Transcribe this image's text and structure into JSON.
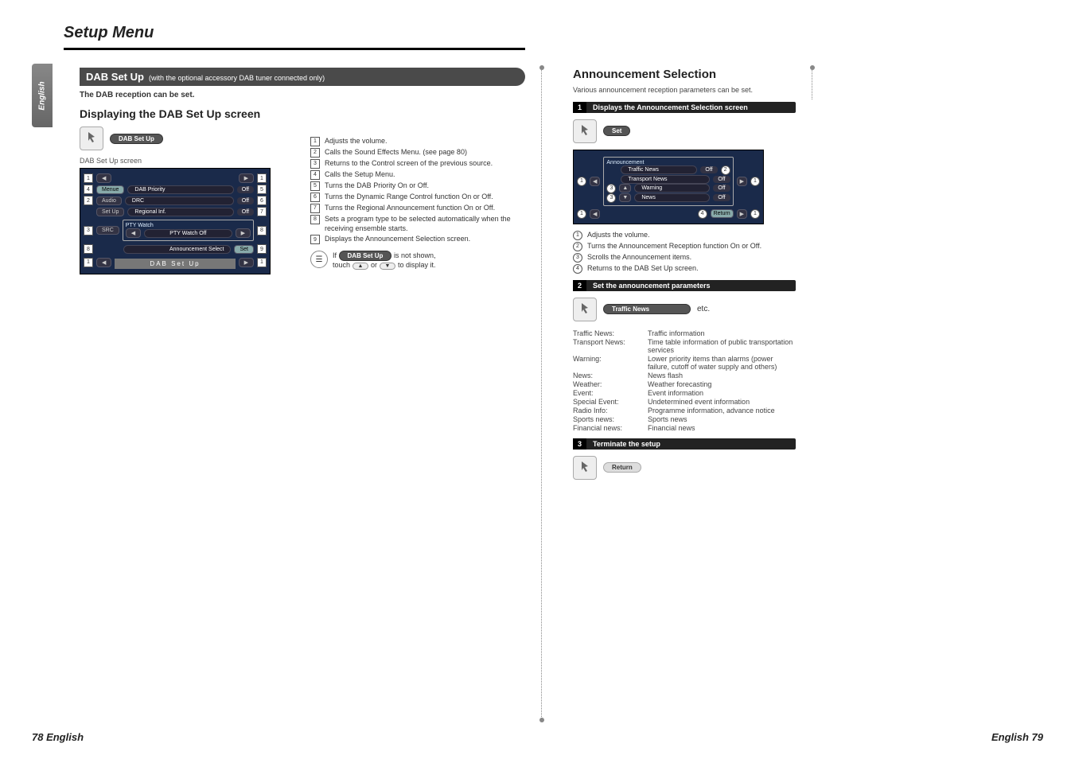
{
  "page": {
    "title": "Setup Menu",
    "lang_tab": "English",
    "footer_left": "78 English",
    "footer_right": "English 79"
  },
  "dab": {
    "banner_title": "DAB Set Up",
    "banner_sub": "(with the optional accessory DAB tuner connected only)",
    "intro": "The DAB reception can be set.",
    "heading": "Displaying the DAB Set Up screen",
    "tap_pill": "DAB Set Up",
    "caption": "DAB Set Up screen",
    "screen": {
      "menu_btn": "Menue",
      "audio_btn": "Audio",
      "setup_btn": "Set Up",
      "src_btn": "SRC",
      "row_priority": {
        "label": "DAB Priority",
        "val": "Off"
      },
      "row_drc": {
        "label": "DRC",
        "val": "Off"
      },
      "row_regional": {
        "label": "Regional Inf.",
        "val": "Off"
      },
      "pty_group": "PTY Watch",
      "row_pty": {
        "label": "PTY Watch Off"
      },
      "row_ann": {
        "label": "Announcement Select",
        "btn": "Set"
      },
      "title_band": "DAB  Set  Up"
    },
    "notes": [
      "Adjusts the volume.",
      "Calls the Sound Effects Menu. (see page 80)",
      "Returns to the Control screen of the previous source.",
      "Calls the Setup Menu.",
      "Turns the DAB Priority On or Off.",
      "Turns the Dynamic Range Control function On or Off.",
      "Turns the Regional Announcement function On or Off.",
      "Sets a program type to be selected automatically when the receiving ensemble starts.",
      "Displays the Announcement Selection screen."
    ],
    "tip_prefix": "If",
    "tip_pill": "DAB Set Up",
    "tip_mid": "is not shown,",
    "tip_line2a": "touch",
    "tip_line2b": "or",
    "tip_line2c": "to display it."
  },
  "ann": {
    "heading": "Announcement Selection",
    "intro": "Various announcement reception parameters can be set.",
    "step1": "Displays the Announcement Selection screen",
    "tap_pill": "Set",
    "screen": {
      "group": "Announcement",
      "rows": [
        {
          "label": "Traffic News",
          "val": "Off"
        },
        {
          "label": "Transport News",
          "val": "Off"
        },
        {
          "label": "Warning",
          "val": "Off"
        },
        {
          "label": "News",
          "val": "Off"
        }
      ],
      "return": "Return"
    },
    "circ_notes": [
      "Adjusts the volume.",
      "Turns the Announcement Reception function On or Off.",
      "Scrolls the Announcement items.",
      "Returns to the DAB Set Up screen."
    ],
    "step2": "Set the announcement parameters",
    "step2_pill": "Traffic News",
    "step2_etc": "etc.",
    "defs": [
      {
        "k": "Traffic News:",
        "v": "Traffic information"
      },
      {
        "k": "Transport News:",
        "v": "Time table information of public transportation services"
      },
      {
        "k": "Warning:",
        "v": "Lower priority items than alarms (power failure, cutoff of water supply and others)"
      },
      {
        "k": "News:",
        "v": "News flash"
      },
      {
        "k": "Weather:",
        "v": "Weather forecasting"
      },
      {
        "k": "Event:",
        "v": "Event information"
      },
      {
        "k": "Special Event:",
        "v": "Undetermined event information"
      },
      {
        "k": "Radio Info:",
        "v": "Programme information, advance notice"
      },
      {
        "k": "Sports news:",
        "v": "Sports news"
      },
      {
        "k": "Financial news:",
        "v": "Financial news"
      }
    ],
    "step3": "Terminate the setup",
    "step3_pill": "Return"
  }
}
